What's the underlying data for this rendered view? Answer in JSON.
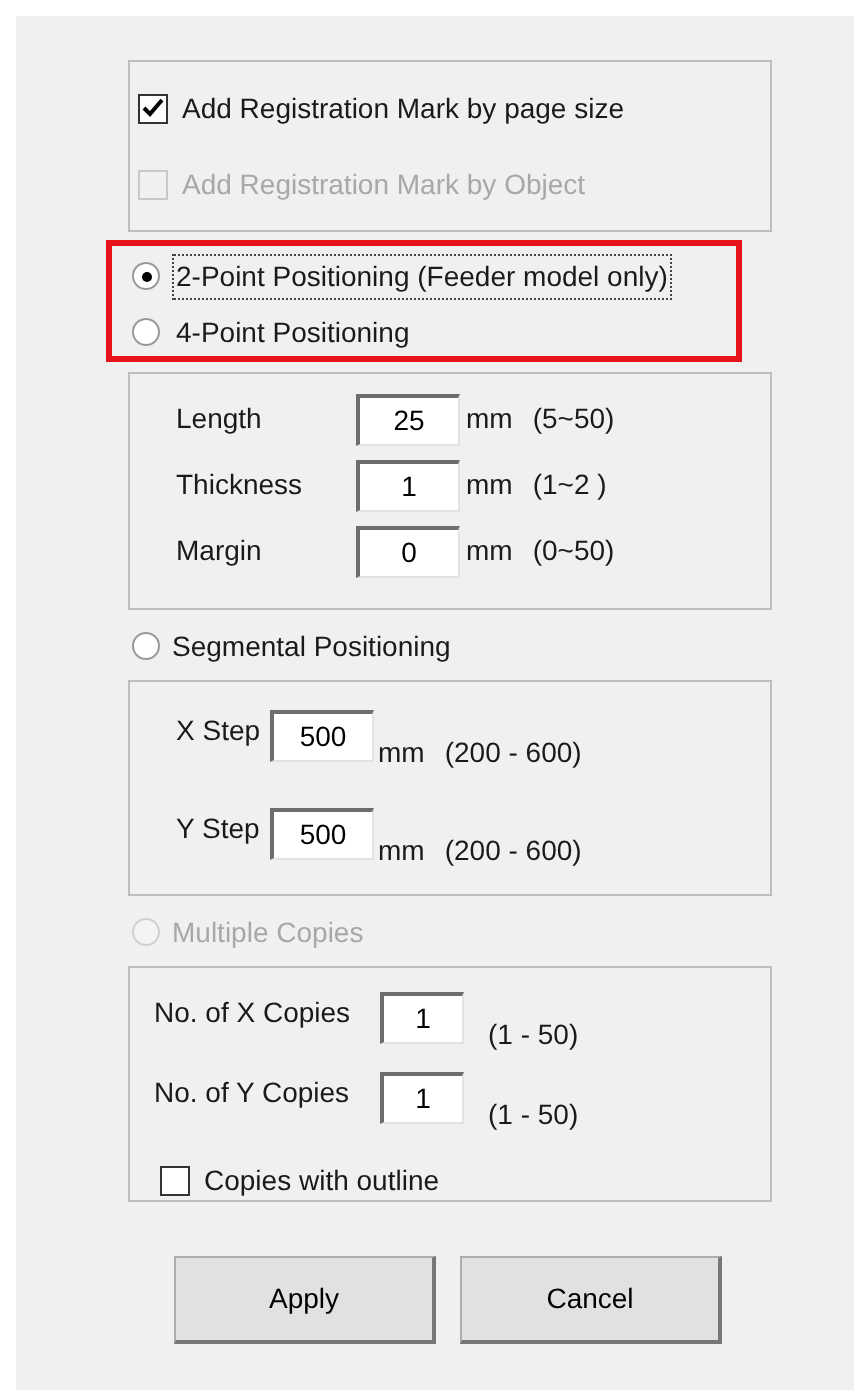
{
  "registration_options": [
    {
      "label": "Add Registration Mark by page size",
      "checked": true,
      "disabled": false
    },
    {
      "label": "Add Registration Mark by Object",
      "checked": false,
      "disabled": true
    }
  ],
  "positioning": [
    {
      "label": "2-Point Positioning (Feeder model only)",
      "selected": true,
      "focused": true
    },
    {
      "label": "4-Point Positioning",
      "selected": false,
      "focused": false
    }
  ],
  "point_settings": [
    {
      "label": "Length",
      "value": "25",
      "unit": "mm",
      "range": "(5~50)"
    },
    {
      "label": "Thickness",
      "value": "1",
      "unit": "mm",
      "range": "(1~2 )"
    },
    {
      "label": "Margin",
      "value": "0",
      "unit": "mm",
      "range": "(0~50)"
    }
  ],
  "segmental": {
    "label": "Segmental Positioning",
    "selected": false,
    "steps": [
      {
        "label": "X Step",
        "value": "500",
        "unit": "mm",
        "range": "(200 - 600)"
      },
      {
        "label": "Y Step",
        "value": "500",
        "unit": "mm",
        "range": "(200 - 600)"
      }
    ]
  },
  "multiple_copies": {
    "label": "Multiple Copies",
    "selected": false,
    "disabled": true,
    "counts": [
      {
        "label": "No. of X Copies",
        "value": "1",
        "range": "(1 - 50)"
      },
      {
        "label": "No. of Y Copies",
        "value": "1",
        "range": "(1 - 50)"
      }
    ],
    "outline": {
      "label": "Copies with outline",
      "checked": false
    }
  },
  "buttons": [
    "Apply",
    "Cancel"
  ]
}
